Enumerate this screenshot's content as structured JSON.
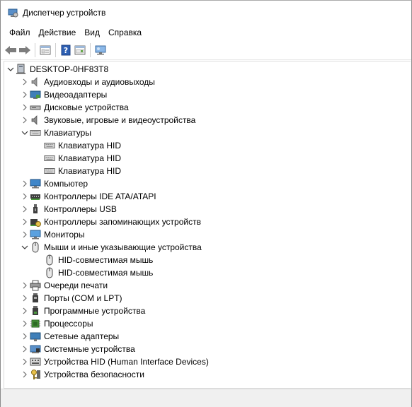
{
  "window": {
    "title": "Диспетчер устройств"
  },
  "menu": [
    {
      "label": "Файл"
    },
    {
      "label": "Действие"
    },
    {
      "label": "Вид"
    },
    {
      "label": "Справка"
    }
  ],
  "toolbar": {
    "buttons": [
      {
        "icon": "back-arrow-icon"
      },
      {
        "icon": "forward-arrow-icon"
      },
      {
        "icon": "properties-icon"
      },
      {
        "icon": "help-icon"
      },
      {
        "icon": "show-hidden-icon"
      },
      {
        "icon": "scan-hardware-icon"
      }
    ]
  },
  "tree": {
    "root": "DESKTOP-0HF83T8",
    "items": [
      {
        "label": "Аудиовходы и аудиовыходы",
        "icon": "speaker-icon",
        "level": 1,
        "state": "collapsed"
      },
      {
        "label": "Видеоадаптеры",
        "icon": "display-adapter-icon",
        "level": 1,
        "state": "collapsed"
      },
      {
        "label": "Дисковые устройства",
        "icon": "disk-drive-icon",
        "level": 1,
        "state": "collapsed"
      },
      {
        "label": "Звуковые, игровые и видеоустройства",
        "icon": "sound-icon",
        "level": 1,
        "state": "collapsed"
      },
      {
        "label": "Клавиатуры",
        "icon": "keyboard-icon",
        "level": 1,
        "state": "expanded"
      },
      {
        "label": "Клавиатура HID",
        "icon": "keyboard-icon",
        "level": 2,
        "state": "leaf"
      },
      {
        "label": "Клавиатура HID",
        "icon": "keyboard-icon",
        "level": 2,
        "state": "leaf"
      },
      {
        "label": "Клавиатура HID",
        "icon": "keyboard-icon",
        "level": 2,
        "state": "leaf"
      },
      {
        "label": "Компьютер",
        "icon": "computer-icon",
        "level": 1,
        "state": "collapsed"
      },
      {
        "label": "Контроллеры IDE ATA/ATAPI",
        "icon": "ide-controller-icon",
        "level": 1,
        "state": "collapsed"
      },
      {
        "label": "Контроллеры USB",
        "icon": "usb-icon",
        "level": 1,
        "state": "collapsed"
      },
      {
        "label": "Контроллеры запоминающих устройств",
        "icon": "storage-controller-icon",
        "level": 1,
        "state": "collapsed"
      },
      {
        "label": "Мониторы",
        "icon": "monitor-icon",
        "level": 1,
        "state": "collapsed"
      },
      {
        "label": "Мыши и иные указывающие устройства",
        "icon": "mouse-icon",
        "level": 1,
        "state": "expanded"
      },
      {
        "label": "HID-совместимая мышь",
        "icon": "mouse-icon",
        "level": 2,
        "state": "leaf"
      },
      {
        "label": "HID-совместимая мышь",
        "icon": "mouse-icon",
        "level": 2,
        "state": "leaf"
      },
      {
        "label": "Очереди печати",
        "icon": "printer-icon",
        "level": 1,
        "state": "collapsed"
      },
      {
        "label": "Порты (COM и LPT)",
        "icon": "port-icon",
        "level": 1,
        "state": "collapsed"
      },
      {
        "label": "Программные устройства",
        "icon": "software-device-icon",
        "level": 1,
        "state": "collapsed"
      },
      {
        "label": "Процессоры",
        "icon": "processor-icon",
        "level": 1,
        "state": "collapsed"
      },
      {
        "label": "Сетевые адаптеры",
        "icon": "network-adapter-icon",
        "level": 1,
        "state": "collapsed"
      },
      {
        "label": "Системные устройства",
        "icon": "system-device-icon",
        "level": 1,
        "state": "collapsed"
      },
      {
        "label": "Устройства HID (Human Interface Devices)",
        "icon": "hid-icon",
        "level": 1,
        "state": "collapsed"
      },
      {
        "label": "Устройства безопасности",
        "icon": "security-device-icon",
        "level": 1,
        "state": "collapsed"
      }
    ]
  }
}
